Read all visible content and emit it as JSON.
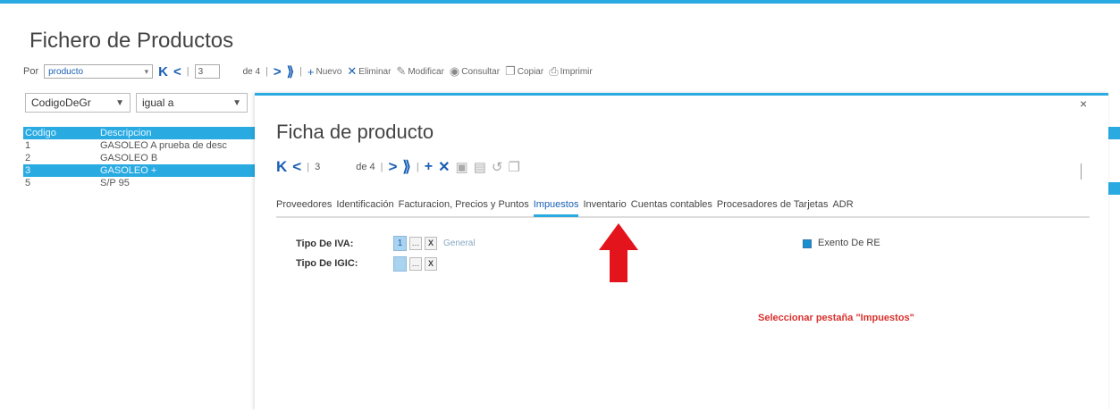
{
  "page": {
    "title": "Fichero de Productos"
  },
  "toolbar": {
    "por_label": "Por",
    "sort_value": "producto",
    "page_value": "3",
    "page_total": "de 4",
    "nuevo": "Nuevo",
    "eliminar": "Eliminar",
    "modificar": "Modificar",
    "consultar": "Consultar",
    "copiar": "Copiar",
    "imprimir": "Imprimir"
  },
  "filter": {
    "field": "CodigoDeGr",
    "operator": "igual a"
  },
  "table": {
    "headers": [
      "Codigo",
      "Descripcion"
    ],
    "rows": [
      {
        "codigo": "1",
        "descripcion": "GASOLEO A prueba de desc"
      },
      {
        "codigo": "2",
        "descripcion": "GASOLEO B"
      },
      {
        "codigo": "3",
        "descripcion": "GASOLEO +"
      },
      {
        "codigo": "5",
        "descripcion": "S/P 95"
      }
    ],
    "selected_index": 2
  },
  "modal": {
    "title": "Ficha de producto",
    "close": "×",
    "page_value": "3",
    "page_total": "de 4",
    "tabs": [
      "Proveedores",
      "Identificación",
      "Facturacion, Precios y Puntos",
      "Impuestos",
      "Inventario",
      "Cuentas contables",
      "Procesadores de Tarjetas",
      "ADR"
    ],
    "active_tab": "Impuestos",
    "fields": {
      "tipo_iva_label": "Tipo De IVA:",
      "tipo_iva_value": "1",
      "tipo_iva_desc": "General",
      "tipo_igic_label": "Tipo De IGIC:",
      "tipo_igic_value": "",
      "exento_label": "Exento De RE",
      "exento_checked": true
    },
    "note": "Seleccionar pestaña \"Impuestos\""
  },
  "colors": {
    "accent": "#29abe2",
    "arrow": "#e3141b",
    "note": "#d9302c"
  }
}
